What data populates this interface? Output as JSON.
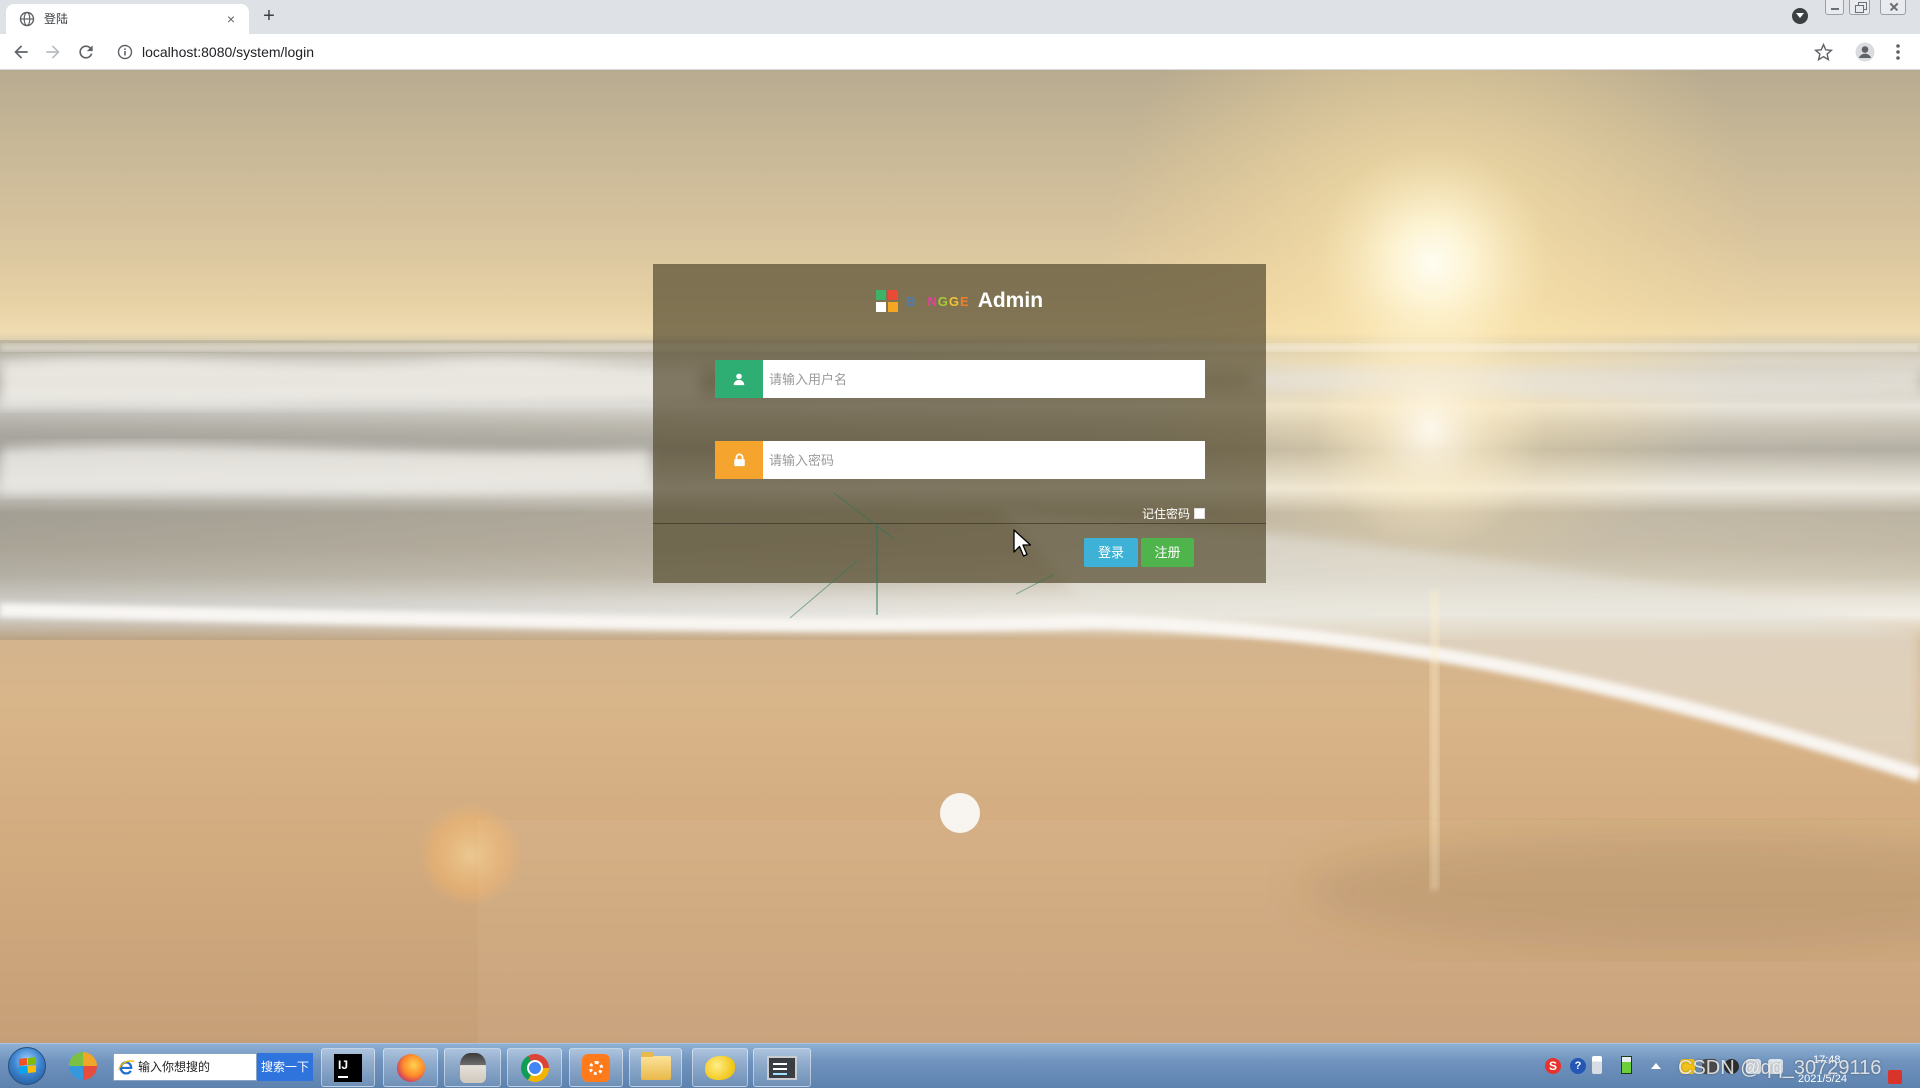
{
  "browser": {
    "tab_title": "登陆",
    "close_tab": "×",
    "new_tab": "+",
    "url": "localhost:8080/system/login"
  },
  "login": {
    "logo": {
      "letters": [
        {
          "char": "B",
          "color": "#3d7fd6"
        },
        {
          "char": "N",
          "color": "#e2409b"
        },
        {
          "char": "G",
          "color": "#a6c936"
        },
        {
          "char": "G",
          "color": "#f2c230"
        },
        {
          "char": "E",
          "color": "#f07c2e"
        }
      ],
      "title": "Admin"
    },
    "username": {
      "placeholder": "请输入用户名",
      "value": "",
      "icon": "user-icon",
      "icon_color": "#2eae72"
    },
    "password": {
      "placeholder": "请输入密码",
      "value": "",
      "icon": "lock-icon",
      "icon_color": "#f5a52e"
    },
    "remember": {
      "label": "记住密码",
      "checked": false
    },
    "buttons": {
      "login": {
        "label": "登录",
        "color": "#3db2d6"
      },
      "register": {
        "label": "注册",
        "color": "#4fb44b"
      }
    }
  },
  "taskbar": {
    "search": {
      "placeholder": "输入你想搜的",
      "button": "搜索一下"
    },
    "intellij_label": "IJ",
    "watermark": "CSDN @qq_30729116",
    "clock": {
      "time": "17:48",
      "date": "2021/5/24"
    }
  }
}
